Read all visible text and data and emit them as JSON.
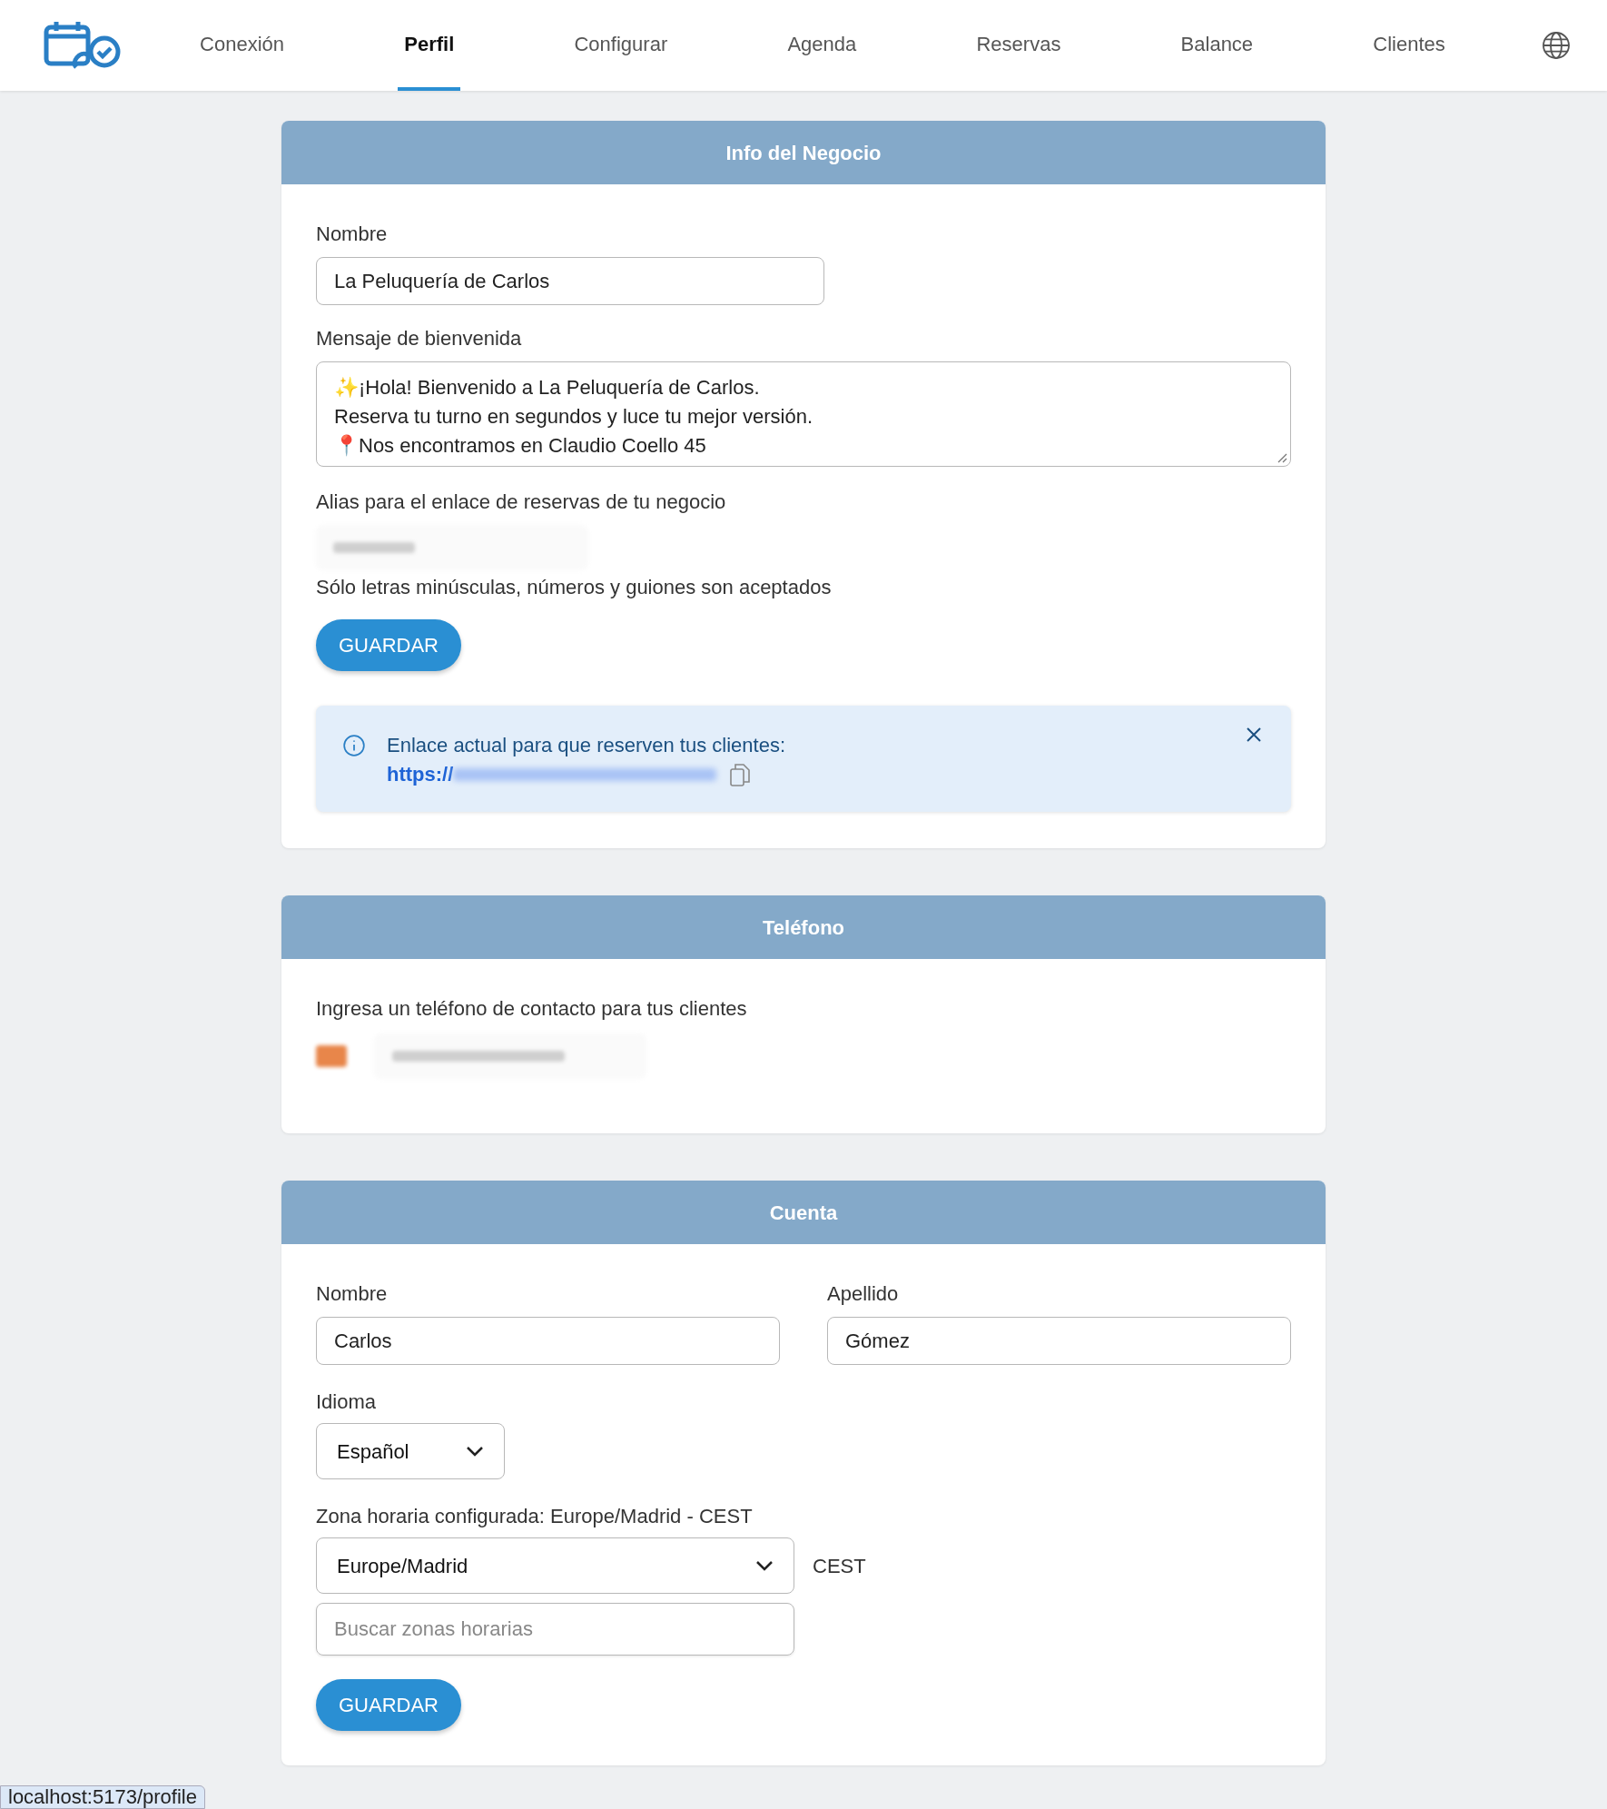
{
  "nav": {
    "tabs": [
      {
        "label": "Conexión",
        "selected": false
      },
      {
        "label": "Perfil",
        "selected": true
      },
      {
        "label": "Configurar",
        "selected": false
      },
      {
        "label": "Agenda",
        "selected": false
      },
      {
        "label": "Reservas",
        "selected": false
      },
      {
        "label": "Balance",
        "selected": false
      },
      {
        "label": "Clientes",
        "selected": false
      }
    ]
  },
  "business": {
    "title": "Info del Negocio",
    "name_label": "Nombre",
    "name_value": "La Peluquería de Carlos",
    "welcome_label": "Mensaje de bienvenida",
    "welcome_lines": [
      "✨¡Hola! Bienvenido a La Peluquería de Carlos.",
      "Reserva tu turno en segundos y luce tu mejor versión.",
      "📍Nos encontramos en Claudio Coello 45"
    ],
    "alias_label": "Alias para el enlace de reservas de tu negocio",
    "alias_help": "Sólo letras minúsculas, números y guiones son aceptados",
    "save": "GUARDAR",
    "alert": {
      "text": "Enlace actual para que reserven tus clientes:",
      "link_prefix": "https://"
    }
  },
  "phone": {
    "title": "Teléfono",
    "label": "Ingresa un teléfono de contacto para tus clientes"
  },
  "account": {
    "title": "Cuenta",
    "first_label": "Nombre",
    "first_value": "Carlos",
    "last_label": "Apellido",
    "last_value": "Gómez",
    "language_label": "Idioma",
    "language_value": "Español",
    "tz_label": "Zona horaria configurada: Europe/Madrid - CEST",
    "tz_value": "Europe/Madrid",
    "tz_abbr": "CEST",
    "tz_search_placeholder": "Buscar zonas horarias",
    "save": "GUARDAR"
  },
  "status_bar": {
    "url": "localhost:5173/profile"
  }
}
